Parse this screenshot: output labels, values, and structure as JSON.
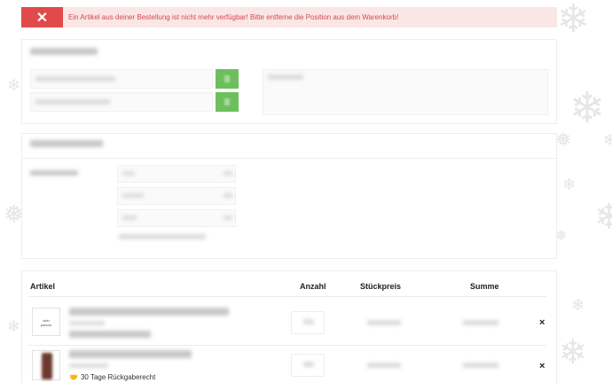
{
  "alert": {
    "close_icon": "✕",
    "message": "Ein Artikel aus deiner Bestellung ist nicht mehr verfügbar! Bitte entferne die Position aus dem Warenkorb!"
  },
  "table": {
    "headers": {
      "article": "Artikel",
      "quantity": "Anzahl",
      "unit_price": "Stückpreis",
      "total": "Summe"
    },
    "rows": [
      {
        "thumb_text": "dein\nparfum",
        "remove": "×"
      },
      {
        "remove": "×",
        "return_policy": "30 Tage Rückgaberecht"
      }
    ]
  },
  "colors": {
    "alert_bg": "#fbe6e6",
    "alert_accent": "#e04a4a",
    "alert_text": "#d44a4a",
    "apply_button": "#6cbf5c"
  },
  "icons": {
    "alert_close": "close-icon",
    "return": "handshake-icon",
    "remove": "close-icon"
  }
}
